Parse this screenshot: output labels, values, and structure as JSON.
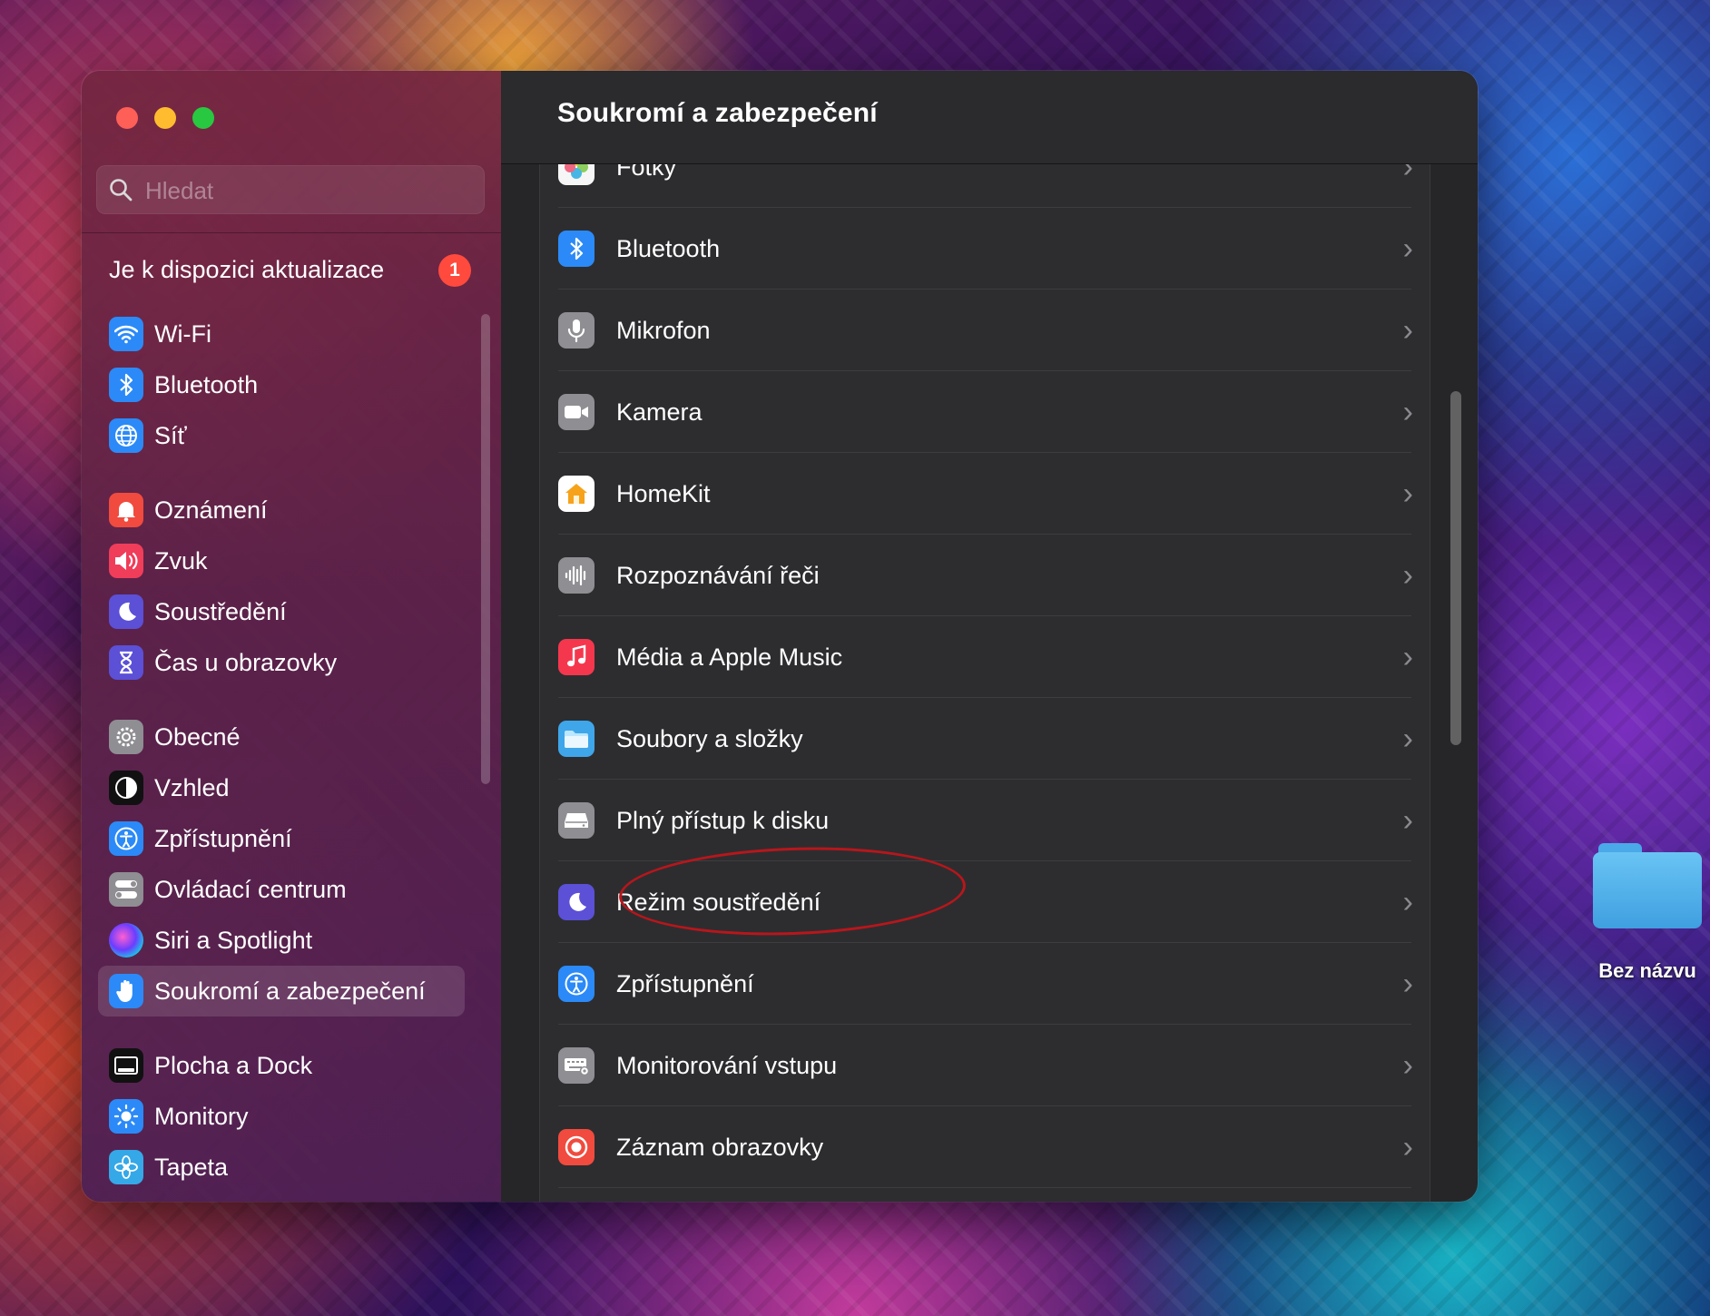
{
  "desktop": {
    "folder_label": "Bez názvu"
  },
  "window": {
    "title": "Soukromí a zabezpečení"
  },
  "search": {
    "placeholder": "Hledat"
  },
  "sidebar": {
    "update_text": "Je k dispozici aktualizace",
    "update_badge": "1",
    "items": [
      {
        "label": "Wi-Fi",
        "icon": "wifi-icon",
        "color": "#2b8af7"
      },
      {
        "label": "Bluetooth",
        "icon": "bluetooth-icon",
        "color": "#2b8af7"
      },
      {
        "label": "Síť",
        "icon": "globe-icon",
        "color": "#2b8af7"
      },
      {
        "label": "Oznámení",
        "icon": "bell-icon",
        "color": "#f04b3e"
      },
      {
        "label": "Zvuk",
        "icon": "speaker-icon",
        "color": "#f03d5a"
      },
      {
        "label": "Soustředění",
        "icon": "moon-icon",
        "color": "#5b50d6"
      },
      {
        "label": "Čas u obrazovky",
        "icon": "hourglass-icon",
        "color": "#5b50d6"
      },
      {
        "label": "Obecné",
        "icon": "gear-icon",
        "color": "#8e8e93"
      },
      {
        "label": "Vzhled",
        "icon": "appearance-icon",
        "color": "#111111"
      },
      {
        "label": "Zpřístupnění",
        "icon": "accessibility-icon",
        "color": "#2b8af7"
      },
      {
        "label": "Ovládací centrum",
        "icon": "toggles-icon",
        "color": "#8e8e93"
      },
      {
        "label": "Siri a Spotlight",
        "icon": "siri-icon",
        "color": "#222244"
      },
      {
        "label": "Soukromí a zabezpečení",
        "icon": "hand-icon",
        "color": "#2b8af7",
        "selected": true
      },
      {
        "label": "Plocha a Dock",
        "icon": "dock-icon",
        "color": "#111111"
      },
      {
        "label": "Monitory",
        "icon": "sun-icon",
        "color": "#2b8af7"
      },
      {
        "label": "Tapeta",
        "icon": "flower-icon",
        "color": "#35a8e8"
      }
    ]
  },
  "main": {
    "rows": [
      {
        "label": "Fotky",
        "icon": "photos-icon",
        "color": "#f6f6f6"
      },
      {
        "label": "Bluetooth",
        "icon": "bluetooth-icon",
        "color": "#2b8af7"
      },
      {
        "label": "Mikrofon",
        "icon": "microphone-icon",
        "color": "#8e8e93"
      },
      {
        "label": "Kamera",
        "icon": "camera-icon",
        "color": "#8e8e93"
      },
      {
        "label": "HomeKit",
        "icon": "home-icon",
        "color": "#ffffff"
      },
      {
        "label": "Rozpoznávání řeči",
        "icon": "waveform-icon",
        "color": "#8e8e93"
      },
      {
        "label": "Média a Apple Music",
        "icon": "music-note-icon",
        "color": "#f5374e"
      },
      {
        "label": "Soubory a složky",
        "icon": "folder-icon",
        "color": "#3fa6ea"
      },
      {
        "label": "Plný přístup k disku",
        "icon": "disk-icon",
        "color": "#8e8e93"
      },
      {
        "label": "Režim soustředění",
        "icon": "moon-icon",
        "color": "#5b50d6"
      },
      {
        "label": "Zpřístupnění",
        "icon": "accessibility-icon",
        "color": "#2b8af7"
      },
      {
        "label": "Monitorování vstupu",
        "icon": "keyboard-icon",
        "color": "#8e8e93"
      },
      {
        "label": "Záznam obrazovky",
        "icon": "record-icon",
        "color": "#f04b3e"
      }
    ]
  }
}
